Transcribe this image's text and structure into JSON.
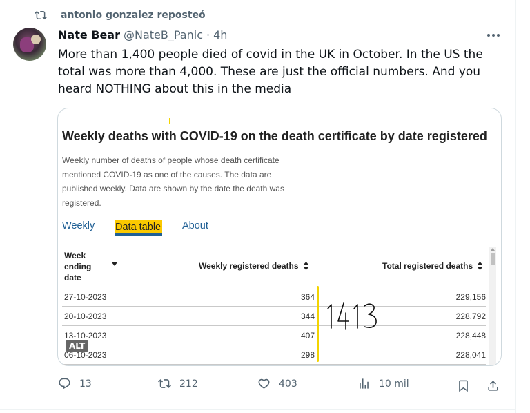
{
  "repost": {
    "text": "antonio gonzalez reposteó",
    "icon": "repost-icon"
  },
  "post": {
    "author_name": "Nate Bear",
    "author_handle": "@NateB_Panic",
    "separator": "·",
    "time": "4h",
    "text": "More than 1,400 people died of covid in the UK in October. In the US the total was more than 4,000. These are just the official numbers. And you heard NOTHING about this in the media"
  },
  "media": {
    "title": "Weekly deaths with COVID-19 on the death certificate by date registered",
    "description": "Weekly number of deaths of people whose death certificate mentioned COVID-19 as one of the causes. The data are published weekly. Data are shown by the date the death was registered.",
    "tabs": [
      "Weekly",
      "Data table",
      "About"
    ],
    "table": {
      "headers": [
        "Week ending date",
        "Weekly registered deaths",
        "Total registered deaths"
      ],
      "rows": [
        [
          "27-10-2023",
          "364",
          "229,156"
        ],
        [
          "20-10-2023",
          "344",
          "228,792"
        ],
        [
          "13-10-2023",
          "407",
          "228,448"
        ],
        [
          "06-10-2023",
          "298",
          "228,041"
        ]
      ]
    },
    "handwritten_note": "1413",
    "alt_badge": "ALT",
    "accent_yellow": "#fbc900",
    "link_blue": "#206095"
  },
  "actions": {
    "replies": "13",
    "reposts": "212",
    "likes": "403",
    "views": "10 mil"
  }
}
